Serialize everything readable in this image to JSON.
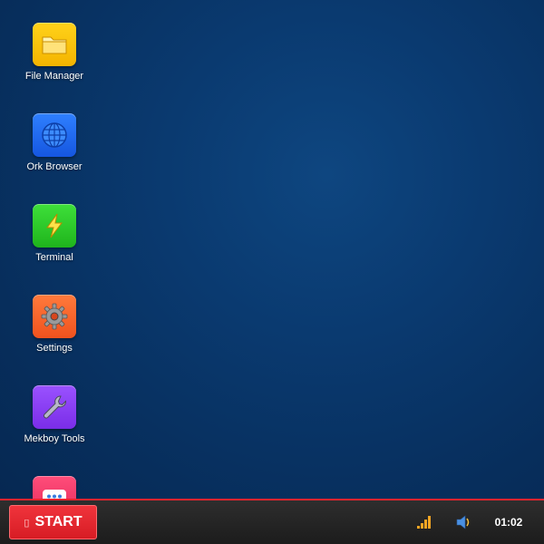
{
  "desktop": {
    "icons": [
      {
        "label": "File Manager",
        "icon": "folder-icon",
        "color": "#f4b400"
      },
      {
        "label": "Ork Browser",
        "icon": "globe-icon",
        "color": "#1556e0"
      },
      {
        "label": "Terminal",
        "icon": "lightning-icon",
        "color": "#1fb41c"
      },
      {
        "label": "Settings",
        "icon": "gear-icon",
        "color": "#f0521e"
      },
      {
        "label": "Mekboy Tools",
        "icon": "wrench-icon",
        "color": "#7a2de8"
      },
      {
        "label": "",
        "icon": "chat-icon",
        "color": "#e62a5a"
      }
    ]
  },
  "taskbar": {
    "start_glyph": "▯",
    "start_label": "START",
    "accent_color": "#e8242e",
    "tray": {
      "network_icon": "signal-bars-icon",
      "volume_icon": "speaker-icon"
    },
    "clock": "01:02"
  }
}
